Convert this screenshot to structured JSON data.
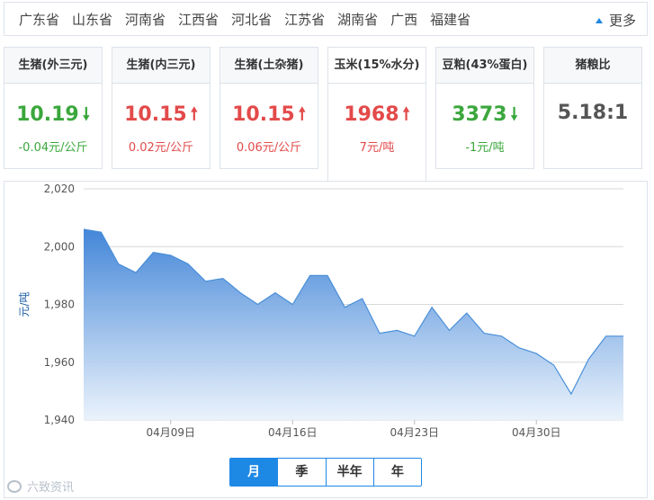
{
  "provinces": [
    "广东省",
    "山东省",
    "河南省",
    "江西省",
    "河北省",
    "江苏省",
    "湖南省",
    "广西",
    "福建省"
  ],
  "more_label": "更多",
  "cards": [
    {
      "title": "生猪(外三元)",
      "value": "10.19",
      "direction": "down",
      "change": "-0.04元/公斤"
    },
    {
      "title": "生猪(内三元)",
      "value": "10.15",
      "direction": "up",
      "change": "0.02元/公斤"
    },
    {
      "title": "生猪(土杂猪)",
      "value": "10.15",
      "direction": "up",
      "change": "0.06元/公斤"
    },
    {
      "title": "玉米(15%水分)",
      "value": "1968",
      "direction": "up",
      "change": "7元/吨"
    },
    {
      "title": "豆粕(43%蛋白)",
      "value": "3373",
      "direction": "down",
      "change": "-1元/吨"
    },
    {
      "title": "猪粮比",
      "value": "5.18:1",
      "direction": "none",
      "change": ""
    }
  ],
  "active_card_index": 3,
  "colors": {
    "accent": "#1e88e5",
    "up": "#e34a4a",
    "down": "#3aa73c",
    "line": "#4a8fd8",
    "area_top": "#3a80d6",
    "area_bottom": "#e8f1fb"
  },
  "icons": {
    "up": "up-arrow-icon",
    "down": "down-arrow-icon",
    "more": "caret-up-icon"
  },
  "period_tabs": [
    "月",
    "季",
    "半年",
    "年"
  ],
  "active_period_index": 0,
  "watermark": "六致资讯",
  "chart_data": {
    "type": "area",
    "ylabel": "元/吨",
    "ylim": [
      1940,
      2020
    ],
    "yticks": [
      1940,
      1960,
      1980,
      2000,
      2020
    ],
    "ytick_labels": [
      "1,940",
      "1,960",
      "1,980",
      "2,000",
      "2,020"
    ],
    "xlim": [
      "2017-04-04",
      "2017-05-05"
    ],
    "xticks": [
      "2017-04-09",
      "2017-04-16",
      "2017-04-23",
      "2017-04-30"
    ],
    "xtick_labels": [
      "04月09日",
      "04月16日",
      "04月23日",
      "04月30日"
    ],
    "grid": true,
    "series": [
      {
        "x": [
          "2017-04-04",
          "2017-04-05",
          "2017-04-06",
          "2017-04-07",
          "2017-04-08",
          "2017-04-09",
          "2017-04-10",
          "2017-04-11",
          "2017-04-12",
          "2017-04-13",
          "2017-04-14",
          "2017-04-15",
          "2017-04-16",
          "2017-04-17",
          "2017-04-18",
          "2017-04-19",
          "2017-04-20",
          "2017-04-21",
          "2017-04-22",
          "2017-04-23",
          "2017-04-24",
          "2017-04-25",
          "2017-04-26",
          "2017-04-27",
          "2017-04-28",
          "2017-04-29",
          "2017-04-30",
          "2017-05-01",
          "2017-05-02",
          "2017-05-03",
          "2017-05-04",
          "2017-05-05"
        ],
        "values": [
          2006,
          2005,
          1994,
          1991,
          1998,
          1997,
          1994,
          1988,
          1989,
          1984,
          1980,
          1984,
          1980,
          1990,
          1990,
          1979,
          1982,
          1970,
          1971,
          1969,
          1979,
          1971,
          1977,
          1970,
          1969,
          1965,
          1963,
          1959,
          1949,
          1961,
          1969,
          1969
        ]
      }
    ]
  }
}
